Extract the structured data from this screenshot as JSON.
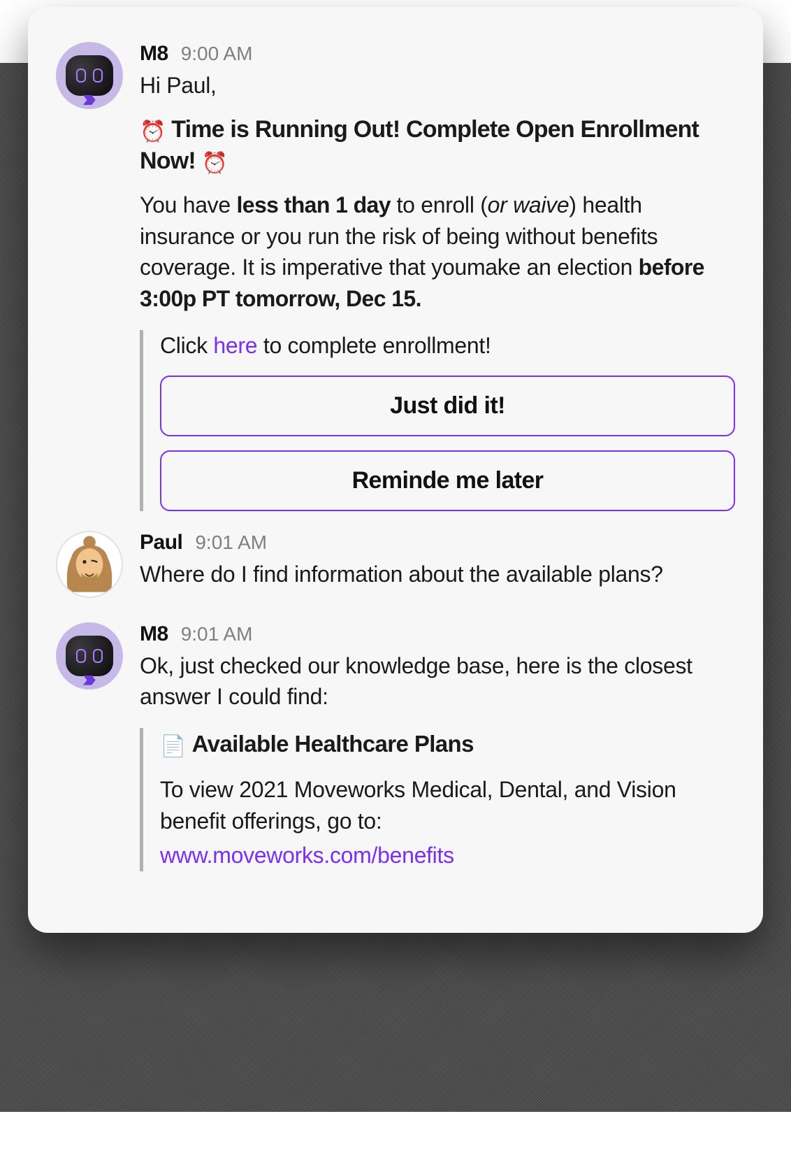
{
  "colors": {
    "accent": "#7b2ff2"
  },
  "messages": [
    {
      "sender": "M8",
      "time": "9:00 AM",
      "greeting": "Hi Paul,",
      "headline_pre_emoji": "⏰",
      "headline": "Time is Running Out! Complete Open Enrollment Now!",
      "headline_post_emoji": "⏰",
      "para_pre": "You have ",
      "para_bold1": "less than 1 day",
      "para_mid1": " to enroll (",
      "para_italic": "or waive",
      "para_mid2": ") health insurance or you run the risk of being without benefits coverage. It is imperative that youmake an election ",
      "para_bold2": "before 3:00p PT tomorrow, Dec 15.",
      "cta_pre": "Click ",
      "cta_link": "here",
      "cta_post": " to complete enrollment!",
      "btn1": "Just did it!",
      "btn2": "Reminde me later"
    },
    {
      "sender": "Paul",
      "time": "9:01 AM",
      "text": "Where do I find information about the available plans?"
    },
    {
      "sender": "M8",
      "time": "9:01 AM",
      "text": "Ok, just checked our knowledge base, here is the closest answer I could find:",
      "doc_emoji": "📄",
      "doc_title": "Available Healthcare Plans",
      "doc_body": "To view 2021 Moveworks Medical, Dental, and Vision benefit offerings, go to:",
      "doc_link": "www.moveworks.com/benefits"
    }
  ]
}
